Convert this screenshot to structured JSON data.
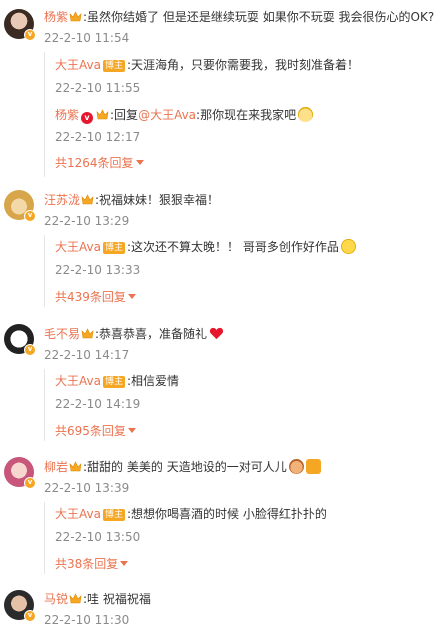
{
  "threads": [
    {
      "user": "杨紫",
      "text": ":虽然你结婚了 但是还是继续玩耍 如果你不玩耍 我会很伤心的OK?",
      "time": "22-2-10 11:54",
      "replies": [
        {
          "user": "大王Ava",
          "tag": "博主",
          "text": ":天涯海角，只要你需要我，我时刻准备着！",
          "time": "22-2-10 11:55"
        },
        {
          "user": "杨紫",
          "prefix": ":回复",
          "mention": "@大王Ava",
          "text": ":那你现在来我家吧",
          "time": "22-2-10 12:17"
        }
      ],
      "more": "共1264条回复"
    },
    {
      "user": "汪苏泷",
      "text": ":祝福妹妹！狠狠幸福！",
      "time": "22-2-10 13:29",
      "replies": [
        {
          "user": "大王Ava",
          "tag": "博主",
          "text": ":这次还不算太晚！！ 哥哥多创作好作品",
          "time": "22-2-10 13:33"
        }
      ],
      "more": "共439条回复"
    },
    {
      "user": "毛不易",
      "text": ":恭喜恭喜，准备随礼",
      "time": "22-2-10 14:17",
      "replies": [
        {
          "user": "大王Ava",
          "tag": "博主",
          "text": ":相信爱情",
          "time": "22-2-10 14:19"
        }
      ],
      "more": "共695条回复"
    },
    {
      "user": "柳岩",
      "text": ":甜甜的 美美的 天造地设的一对可人儿",
      "time": "22-2-10 13:39",
      "replies": [
        {
          "user": "大王Ava",
          "tag": "博主",
          "text": ":想想你喝喜酒的时候 小脸得红扑扑的",
          "time": "22-2-10 13:50"
        }
      ],
      "more": "共38条回复"
    },
    {
      "user": "马锐",
      "text": ":哇 祝福祝福",
      "time": "22-2-10 11:30"
    }
  ],
  "colors": {
    "accent": "#eb7350",
    "time": "#8a8a8a",
    "tag": "#f5a623",
    "vip": "#e6162d"
  }
}
